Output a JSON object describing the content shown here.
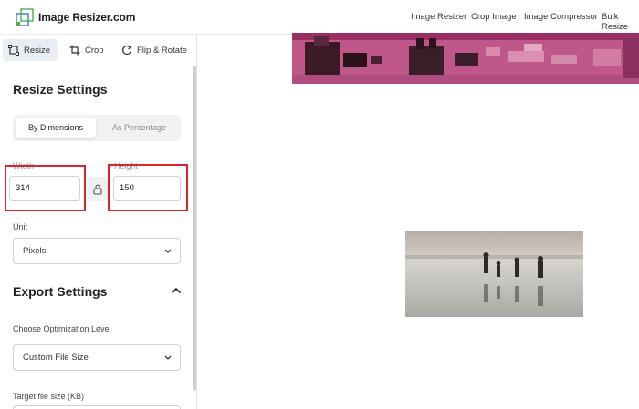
{
  "header": {
    "brand": "Image Resizer.com",
    "nav": [
      "Image Resizer",
      "Crop Image",
      "Image Compressor",
      "Bulk Resize"
    ]
  },
  "tools": [
    {
      "label": "Resize",
      "icon": "resize-icon",
      "active": true
    },
    {
      "label": "Crop",
      "icon": "crop-icon",
      "active": false
    },
    {
      "label": "Flip & Rotate",
      "icon": "rotate-icon",
      "active": false
    }
  ],
  "resize": {
    "heading": "Resize Settings",
    "modes": [
      "By Dimensions",
      "As Percentage"
    ],
    "active_mode": "By Dimensions",
    "width_label": "Width",
    "width_value": "314",
    "height_label": "Height",
    "height_value": "150",
    "unit_label": "Unit",
    "unit_value": "Pixels"
  },
  "export": {
    "heading": "Export Settings",
    "opt_label": "Choose Optimization Level",
    "opt_value": "Custom File Size",
    "target_label": "Target file size (KB)"
  },
  "colors": {
    "highlight": "#d8262a",
    "active_tab": "#e9edf4",
    "banner": "#c0578a"
  }
}
